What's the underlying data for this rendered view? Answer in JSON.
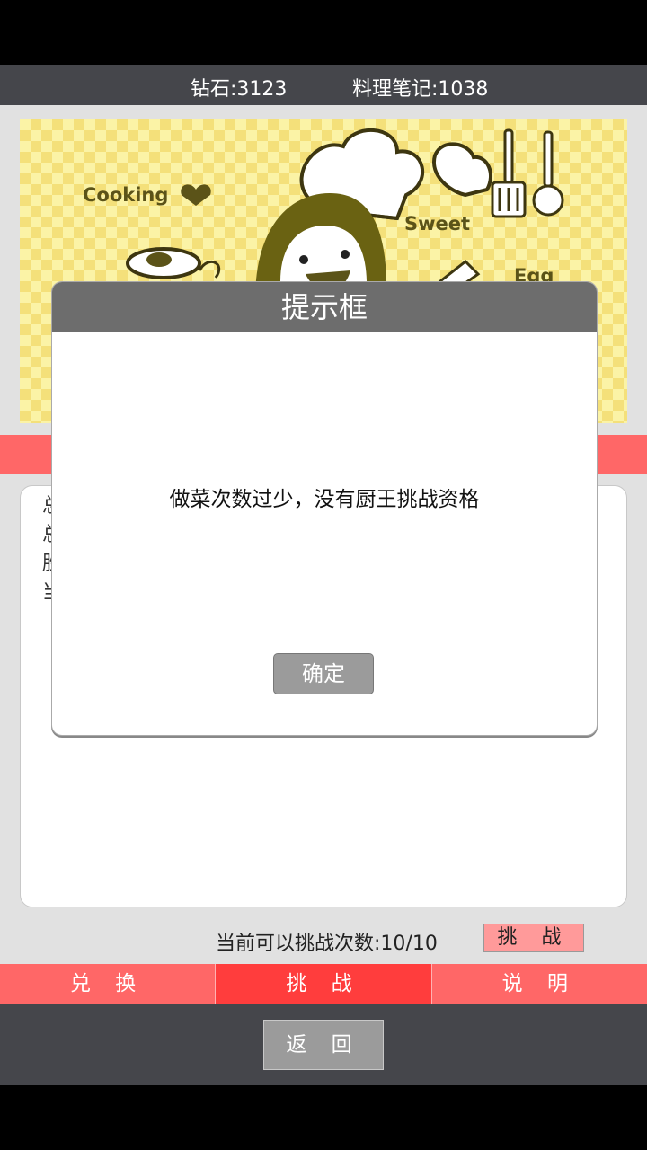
{
  "header": {
    "diamonds": "钻石:3123",
    "notes": "料理笔记:1038"
  },
  "banner": {
    "words": [
      "Cooking",
      "Sweet",
      "Egg"
    ]
  },
  "info": {
    "lines": [
      "总",
      "总",
      "胜",
      "当"
    ]
  },
  "challenge": {
    "remaining_text": "当前可以挑战次数:10/10",
    "button_label": "挑 战"
  },
  "tabs": {
    "items": [
      {
        "label": "兑 换"
      },
      {
        "label": "挑 战"
      },
      {
        "label": "说 明"
      }
    ],
    "active_index": 1
  },
  "footer": {
    "back_label": "返 回"
  },
  "dialog": {
    "title": "提示框",
    "message": "做菜次数过少，没有厨王挑战资格",
    "ok_label": "确定"
  },
  "colors": {
    "tab_bg": "#ff6767",
    "tab_active": "#ff3d3d",
    "bar_bg": "#45464b",
    "dialog_header": "#6d6d6d"
  },
  "icons": [
    "chef-illustration",
    "heart-icon",
    "fried-egg-icon",
    "oven-mitt-icon",
    "spatula-icon",
    "ladle-icon",
    "whisk-icon"
  ]
}
